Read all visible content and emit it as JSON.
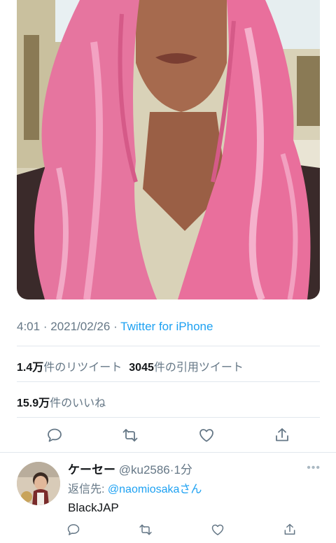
{
  "tweet": {
    "time": "4:01",
    "date": "2021/02/26",
    "source": "Twitter for iPhone",
    "separator": "·",
    "retweets_count": "1.4万",
    "retweets_label": "件のリツイート",
    "quotes_count": "3045",
    "quotes_label": "件の引用ツイート",
    "likes_count": "15.9万",
    "likes_label": "件のいいね"
  },
  "actions": {
    "reply_icon": "reply-icon",
    "retweet_icon": "retweet-icon",
    "like_icon": "like-icon",
    "share_icon": "share-icon"
  },
  "reply": {
    "name": "ケーセー",
    "handle": "@ku2586",
    "dot": "·",
    "time": "1分",
    "more": "•••",
    "replying_to_label": "返信先: ",
    "replying_to_user": "@naomiosaka",
    "replying_to_suffix": "さん",
    "text": "BlackJAP"
  },
  "colors": {
    "accent": "#1da1f2",
    "muted": "#657786",
    "text": "#14171a",
    "border": "#e1e8ed"
  }
}
